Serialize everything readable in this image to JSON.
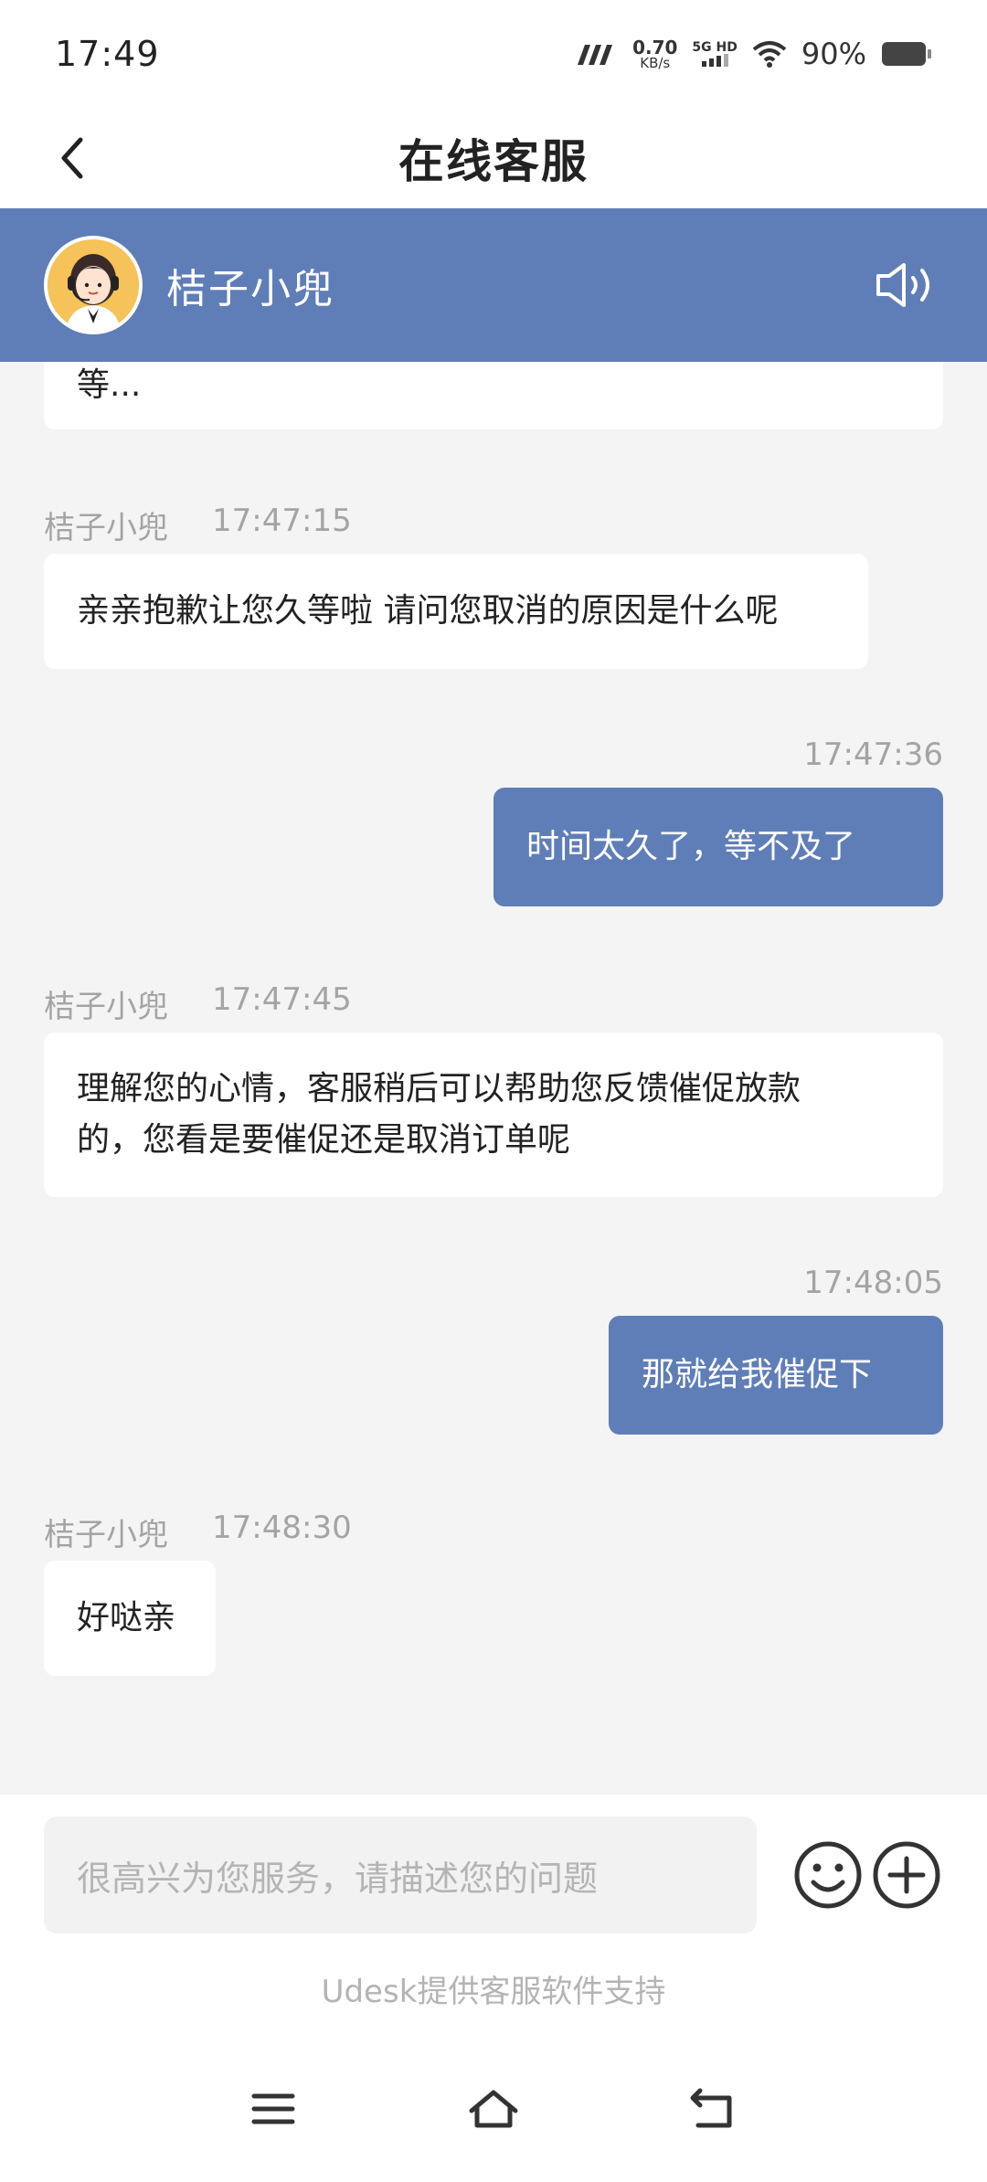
{
  "status_bar": {
    "time": "17:49",
    "net_speed": "0.70",
    "net_unit": "KB/s",
    "network_type": "5G HD",
    "battery": "90%",
    "icons": [
      "signal-icon",
      "wifi-icon",
      "battery-icon"
    ]
  },
  "header": {
    "title": "在线客服",
    "back_icon": "chevron-left-icon"
  },
  "agent": {
    "name": "桔子小兜",
    "avatar": "agent-avatar",
    "speaker_icon": "speaker-icon",
    "brand_color": "#5f7eb8"
  },
  "messages": [
    {
      "from": "agent",
      "text": "等..."
    },
    {
      "from": "agent",
      "sender": "桔子小兜",
      "time": "17:47:15",
      "text": "亲亲抱歉让您久等啦 请问您取消的原因是什么呢"
    },
    {
      "from": "user",
      "time": "17:47:36",
      "text": "时间太久了，等不及了"
    },
    {
      "from": "agent",
      "sender": "桔子小兜",
      "time": "17:47:45",
      "lines": [
        "理解您的心情，客服稍后可以帮助您反馈催促放款",
        "的，您看是要催促还是取消订单呢"
      ]
    },
    {
      "from": "user",
      "time": "17:48:05",
      "text": "那就给我催促下"
    },
    {
      "from": "agent",
      "sender": "桔子小兜",
      "time": "17:48:30",
      "text": "好哒亲"
    }
  ],
  "input": {
    "placeholder": "很高兴为您服务，请描述您的问题",
    "emoji_icon": "emoji-icon",
    "plus_icon": "plus-icon"
  },
  "footer": {
    "powered_by": "Udesk提供客服软件支持"
  },
  "nav": {
    "icons": [
      "menu-icon",
      "home-icon",
      "back-icon"
    ]
  }
}
